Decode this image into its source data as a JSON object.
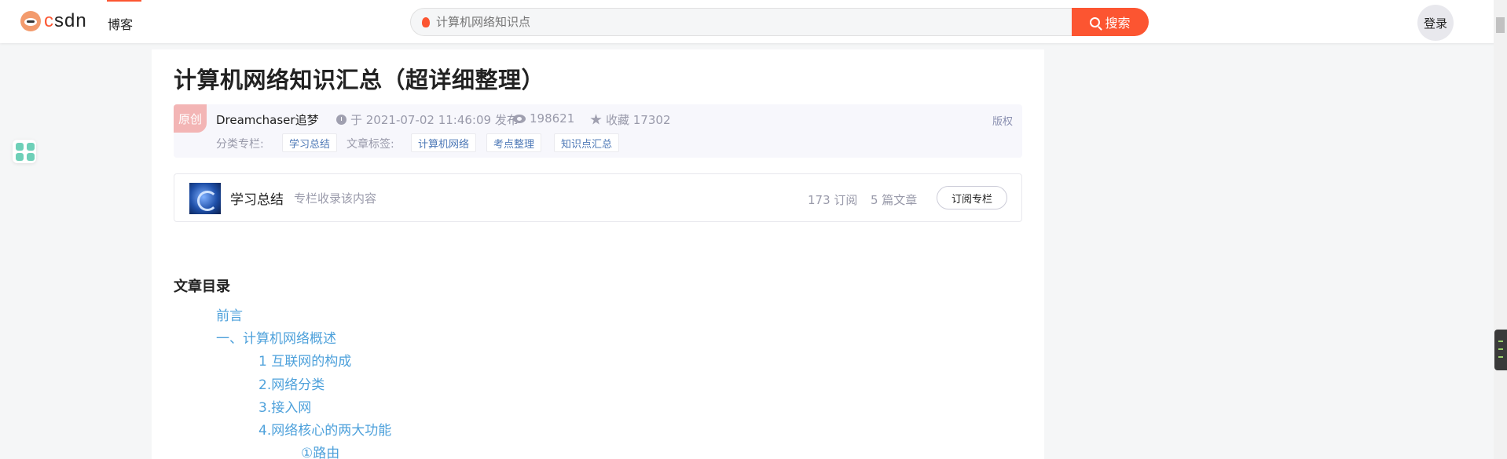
{
  "header": {
    "logo_text": "csdn",
    "nav_blog": "博客",
    "search_placeholder": "计算机网络知识点",
    "search_button": "搜索",
    "login": "登录"
  },
  "article": {
    "title": "计算机网络知识汇总（超详细整理）",
    "badge": "原创",
    "author": "Dreamchaser追梦",
    "published": "于 2021-07-02 11:46:09 发布",
    "views": "198621",
    "favorites": "收藏 17302",
    "copyright": "版权",
    "category_label": "分类专栏:",
    "category": "学习总结",
    "tags_label": "文章标签:",
    "tags": [
      "计算机网络",
      "考点整理",
      "知识点汇总"
    ]
  },
  "column": {
    "name": "学习总结",
    "desc": "专栏收录该内容",
    "subscribers": "173 订阅",
    "articles": "5 篇文章",
    "subscribe_button": "订阅专栏"
  },
  "toc": {
    "title": "文章目录",
    "items": [
      {
        "label": "前言",
        "level": 1
      },
      {
        "label": "一、计算机网络概述",
        "level": 1
      },
      {
        "label": "1 互联网的构成",
        "level": 2
      },
      {
        "label": "2.网络分类",
        "level": 2
      },
      {
        "label": "3.接入网",
        "level": 2
      },
      {
        "label": "4.网络核心的两大功能",
        "level": 2
      },
      {
        "label": "①路由",
        "level": 3
      }
    ]
  },
  "colors": {
    "accent": "#fc5531",
    "link": "#4ea1db",
    "tag_text": "#4e79b7",
    "muted": "#999aaa"
  }
}
